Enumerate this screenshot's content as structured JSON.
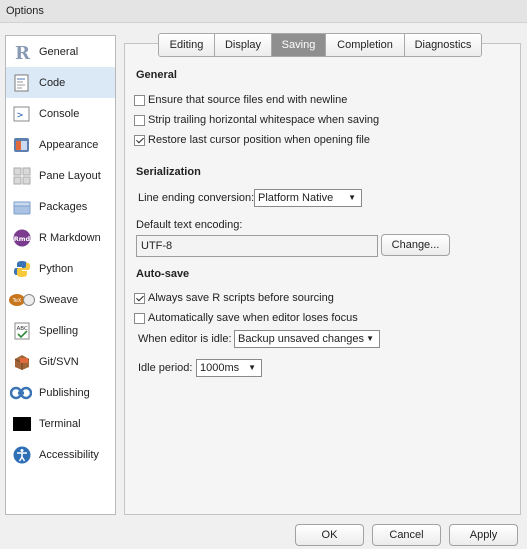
{
  "window": {
    "title": "Options"
  },
  "sidebar": {
    "items": [
      {
        "label": "General",
        "icon": "r-logo-icon"
      },
      {
        "label": "Code",
        "icon": "code-icon",
        "selected": true
      },
      {
        "label": "Console",
        "icon": "console-icon"
      },
      {
        "label": "Appearance",
        "icon": "appearance-icon"
      },
      {
        "label": "Pane Layout",
        "icon": "pane-layout-icon"
      },
      {
        "label": "Packages",
        "icon": "packages-icon"
      },
      {
        "label": "R Markdown",
        "icon": "rmd-icon"
      },
      {
        "label": "Python",
        "icon": "python-icon"
      },
      {
        "label": "Sweave",
        "icon": "sweave-icon"
      },
      {
        "label": "Spelling",
        "icon": "spelling-icon"
      },
      {
        "label": "Git/SVN",
        "icon": "git-icon"
      },
      {
        "label": "Publishing",
        "icon": "publishing-icon"
      },
      {
        "label": "Terminal",
        "icon": "terminal-icon"
      },
      {
        "label": "Accessibility",
        "icon": "accessibility-icon"
      }
    ]
  },
  "tabs": [
    "Editing",
    "Display",
    "Saving",
    "Completion",
    "Diagnostics"
  ],
  "active_tab": "Saving",
  "general": {
    "heading": "General",
    "options": [
      {
        "label": "Ensure that source files end with newline",
        "checked": false
      },
      {
        "label": "Strip trailing horizontal whitespace when saving",
        "checked": false
      },
      {
        "label": "Restore last cursor position when opening file",
        "checked": true
      }
    ]
  },
  "serialization": {
    "heading": "Serialization",
    "line_ending_label": "Line ending conversion:",
    "line_ending_value": "Platform Native",
    "encoding_label": "Default text encoding:",
    "encoding_value": "UTF-8",
    "change_button": "Change..."
  },
  "autosave": {
    "heading": "Auto-save",
    "options": [
      {
        "label": "Always save R scripts before sourcing",
        "checked": true
      },
      {
        "label": "Automatically save when editor loses focus",
        "checked": false
      }
    ],
    "idle_label": "When editor is idle:",
    "idle_value": "Backup unsaved changes",
    "period_label": "Idle period:",
    "period_value": "1000ms"
  },
  "footer": {
    "ok": "OK",
    "cancel": "Cancel",
    "apply": "Apply"
  },
  "colors": {
    "selected_bg": "#dbe9f7",
    "active_tab_bg": "#8f8f8f"
  }
}
